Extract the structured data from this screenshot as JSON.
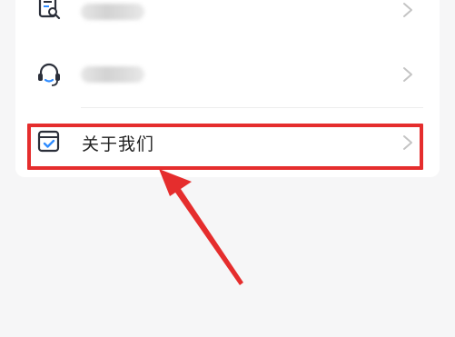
{
  "menu": {
    "items": [
      {
        "icon": "document-search-icon",
        "label": "",
        "blurred": true
      },
      {
        "icon": "headset-icon",
        "label": "",
        "blurred": true
      },
      {
        "icon": "calendar-check-icon",
        "label": "关于我们",
        "blurred": false
      }
    ]
  },
  "annotation": {
    "highlight_color": "#e52d2d",
    "arrow_color": "#e52d2d"
  },
  "colors": {
    "icon_dark": "#2b2f3a",
    "icon_accent": "#2f8cff",
    "chevron": "#c4c4c4",
    "background": "#f6f6f7"
  }
}
